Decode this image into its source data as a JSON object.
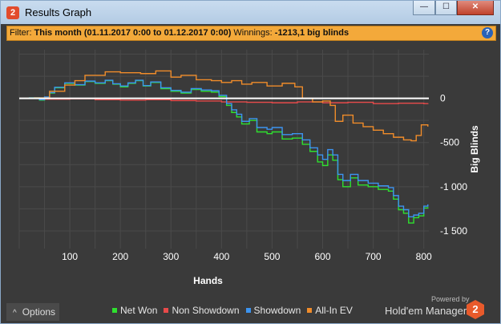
{
  "window": {
    "title": "Results Graph",
    "app_icon_label": "2",
    "buttons": {
      "minimize": "—",
      "maximize": "☐",
      "close": "✕"
    }
  },
  "filter": {
    "label": "Filter:",
    "range": "This month (01.11.2017 0:00 to 01.12.2017 0:00)",
    "winnings_label": "Winnings:",
    "winnings_value": "-1213,1 big blinds",
    "help_icon": "?"
  },
  "footer": {
    "options_label": "Options",
    "options_icon": "^",
    "powered_by": "Powered by",
    "brand": "Hold'em Manager",
    "brand_logo": "2"
  },
  "chart_data": {
    "type": "line",
    "xlabel": "Hands",
    "ylabel": "Big Blinds",
    "xlim": [
      0,
      810
    ],
    "ylim": [
      -1700,
      550
    ],
    "x_ticks": [
      100,
      200,
      300,
      400,
      500,
      600,
      700,
      800
    ],
    "y_ticks": [
      0,
      -500,
      -1000,
      -1500
    ],
    "y_tick_labels": [
      "0",
      "-500",
      "-1 000",
      "-1 500"
    ],
    "grid": true,
    "legend_position": "bottom",
    "zero_line_color": "#ffffff",
    "series": [
      {
        "name": "Net Won",
        "color": "#2ee02e",
        "points": [
          [
            0,
            0
          ],
          [
            20,
            5
          ],
          [
            40,
            -20
          ],
          [
            50,
            10
          ],
          [
            60,
            60
          ],
          [
            70,
            120
          ],
          [
            90,
            170
          ],
          [
            110,
            150
          ],
          [
            130,
            190
          ],
          [
            150,
            170
          ],
          [
            170,
            200
          ],
          [
            185,
            160
          ],
          [
            200,
            130
          ],
          [
            215,
            170
          ],
          [
            230,
            200
          ],
          [
            245,
            140
          ],
          [
            260,
            180
          ],
          [
            280,
            110
          ],
          [
            300,
            80
          ],
          [
            320,
            60
          ],
          [
            340,
            100
          ],
          [
            360,
            80
          ],
          [
            380,
            70
          ],
          [
            395,
            20
          ],
          [
            410,
            -80
          ],
          [
            420,
            -160
          ],
          [
            430,
            -210
          ],
          [
            440,
            -290
          ],
          [
            455,
            -250
          ],
          [
            470,
            -380
          ],
          [
            490,
            -400
          ],
          [
            500,
            -380
          ],
          [
            520,
            -460
          ],
          [
            540,
            -450
          ],
          [
            560,
            -520
          ],
          [
            575,
            -600
          ],
          [
            590,
            -720
          ],
          [
            600,
            -760
          ],
          [
            610,
            -640
          ],
          [
            620,
            -700
          ],
          [
            630,
            -920
          ],
          [
            640,
            -1000
          ],
          [
            655,
            -900
          ],
          [
            670,
            -980
          ],
          [
            690,
            -1000
          ],
          [
            710,
            -1030
          ],
          [
            730,
            -1050
          ],
          [
            740,
            -1140
          ],
          [
            750,
            -1260
          ],
          [
            760,
            -1300
          ],
          [
            770,
            -1410
          ],
          [
            780,
            -1350
          ],
          [
            790,
            -1330
          ],
          [
            800,
            -1240
          ],
          [
            808,
            -1230
          ]
        ]
      },
      {
        "name": "Non Showdown",
        "color": "#e84a4a",
        "points": [
          [
            0,
            0
          ],
          [
            50,
            -10
          ],
          [
            100,
            -5
          ],
          [
            150,
            -15
          ],
          [
            200,
            -20
          ],
          [
            250,
            -15
          ],
          [
            300,
            -25
          ],
          [
            350,
            -30
          ],
          [
            400,
            -40
          ],
          [
            450,
            -45
          ],
          [
            500,
            -50
          ],
          [
            550,
            -40
          ],
          [
            600,
            -50
          ],
          [
            650,
            -45
          ],
          [
            700,
            -60
          ],
          [
            750,
            -55
          ],
          [
            800,
            -60
          ],
          [
            808,
            -55
          ]
        ]
      },
      {
        "name": "Showdown",
        "color": "#3c94f0",
        "points": [
          [
            0,
            0
          ],
          [
            20,
            5
          ],
          [
            40,
            -15
          ],
          [
            50,
            15
          ],
          [
            60,
            65
          ],
          [
            70,
            125
          ],
          [
            90,
            175
          ],
          [
            110,
            155
          ],
          [
            130,
            195
          ],
          [
            150,
            175
          ],
          [
            170,
            205
          ],
          [
            185,
            165
          ],
          [
            200,
            140
          ],
          [
            215,
            175
          ],
          [
            230,
            205
          ],
          [
            245,
            145
          ],
          [
            260,
            185
          ],
          [
            280,
            120
          ],
          [
            300,
            90
          ],
          [
            320,
            70
          ],
          [
            340,
            110
          ],
          [
            360,
            95
          ],
          [
            380,
            85
          ],
          [
            395,
            35
          ],
          [
            410,
            -60
          ],
          [
            420,
            -130
          ],
          [
            430,
            -180
          ],
          [
            440,
            -260
          ],
          [
            455,
            -230
          ],
          [
            470,
            -330
          ],
          [
            490,
            -350
          ],
          [
            500,
            -330
          ],
          [
            520,
            -410
          ],
          [
            540,
            -400
          ],
          [
            560,
            -470
          ],
          [
            575,
            -560
          ],
          [
            590,
            -640
          ],
          [
            600,
            -690
          ],
          [
            610,
            -580
          ],
          [
            620,
            -640
          ],
          [
            630,
            -860
          ],
          [
            640,
            -930
          ],
          [
            655,
            -860
          ],
          [
            670,
            -930
          ],
          [
            690,
            -960
          ],
          [
            710,
            -990
          ],
          [
            730,
            -1010
          ],
          [
            740,
            -1100
          ],
          [
            750,
            -1220
          ],
          [
            760,
            -1260
          ],
          [
            770,
            -1340
          ],
          [
            780,
            -1320
          ],
          [
            790,
            -1300
          ],
          [
            800,
            -1220
          ],
          [
            808,
            -1200
          ]
        ]
      },
      {
        "name": "All-In EV",
        "color": "#f08c2a",
        "points": [
          [
            0,
            0
          ],
          [
            30,
            5
          ],
          [
            60,
            80
          ],
          [
            90,
            150
          ],
          [
            110,
            200
          ],
          [
            130,
            260
          ],
          [
            170,
            300
          ],
          [
            200,
            290
          ],
          [
            240,
            280
          ],
          [
            270,
            310
          ],
          [
            300,
            240
          ],
          [
            320,
            260
          ],
          [
            350,
            210
          ],
          [
            380,
            200
          ],
          [
            400,
            180
          ],
          [
            420,
            200
          ],
          [
            440,
            160
          ],
          [
            460,
            180
          ],
          [
            490,
            140
          ],
          [
            520,
            170
          ],
          [
            545,
            130
          ],
          [
            560,
            0
          ],
          [
            580,
            -40
          ],
          [
            600,
            -30
          ],
          [
            615,
            -80
          ],
          [
            625,
            -260
          ],
          [
            640,
            -190
          ],
          [
            660,
            -280
          ],
          [
            680,
            -320
          ],
          [
            700,
            -360
          ],
          [
            720,
            -400
          ],
          [
            740,
            -440
          ],
          [
            760,
            -470
          ],
          [
            775,
            -480
          ],
          [
            785,
            -420
          ],
          [
            795,
            -300
          ],
          [
            808,
            -320
          ]
        ]
      }
    ]
  }
}
